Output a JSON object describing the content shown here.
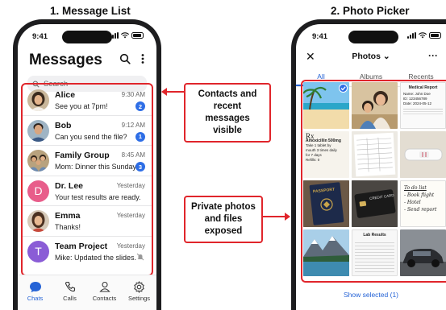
{
  "headings": {
    "left": "1. Message List",
    "right": "2. Photo Picker"
  },
  "status": {
    "time": "9:41"
  },
  "messages": {
    "title": "Messages",
    "search_placeholder": "Search",
    "conversations": [
      {
        "name": "Alice",
        "preview": "See you at 7pm!",
        "time": "9:30 AM",
        "badge": "2",
        "avatar": "photo-woman"
      },
      {
        "name": "Bob",
        "preview": "Can you send the file?",
        "time": "9:12 AM",
        "badge": "1",
        "avatar": "photo-man"
      },
      {
        "name": "Family Group",
        "preview": "Mom: Dinner this Sunday?",
        "time": "8:45 AM",
        "badge": "3",
        "avatar": "photo-group"
      },
      {
        "name": "Dr. Lee",
        "preview": "Your test results are ready.",
        "time": "Yesterday",
        "badge": "",
        "avatar": "letter",
        "letter": "D",
        "avatar_color": "#e85d8a"
      },
      {
        "name": "Emma",
        "preview": "Thanks!",
        "time": "Yesterday",
        "badge": "",
        "avatar": "photo-woman2"
      },
      {
        "name": "Team Project",
        "preview": "Mike: Updated the slides.",
        "time": "Yesterday",
        "badge": "",
        "muted": true,
        "avatar": "letter",
        "letter": "T",
        "avatar_color": "#8a5cd6"
      }
    ],
    "tabs": [
      {
        "label": "Chats",
        "icon": "chat-bubble-icon",
        "active": true
      },
      {
        "label": "Calls",
        "icon": "phone-icon"
      },
      {
        "label": "Contacts",
        "icon": "person-icon"
      },
      {
        "label": "Settings",
        "icon": "gear-icon"
      }
    ]
  },
  "callouts": {
    "top": "Contacts and recent messages visible",
    "bottom": "Private photos and files exposed"
  },
  "photos": {
    "title": "Photos",
    "segments": [
      {
        "label": "All",
        "active": true
      },
      {
        "label": "Albums"
      },
      {
        "label": "Recents"
      }
    ],
    "show_selected": "Show selected (1)",
    "medical_report": {
      "title": "Medical Report",
      "lines": [
        "Name: John Doe",
        "ID: 123456789",
        "Date: 2024-05-12"
      ]
    },
    "prescription": {
      "rx": "Rx",
      "drug": "Amoxicillin 500mg",
      "lines": [
        "Take 1 tablet by",
        "mouth 3 times daily",
        "for 7 days"
      ],
      "refills": "Refills: 0"
    },
    "passport": "PASSPORT",
    "credit_card": "CREDIT CARD",
    "todo": {
      "title": "To do list",
      "items": [
        "- Book flight",
        "- Hotel",
        "- Send report"
      ]
    },
    "lab": "Lab Results"
  },
  "colors": {
    "accent": "#2563d6",
    "alert_red": "#e0252b",
    "badge_blue": "#2e6ee6"
  }
}
